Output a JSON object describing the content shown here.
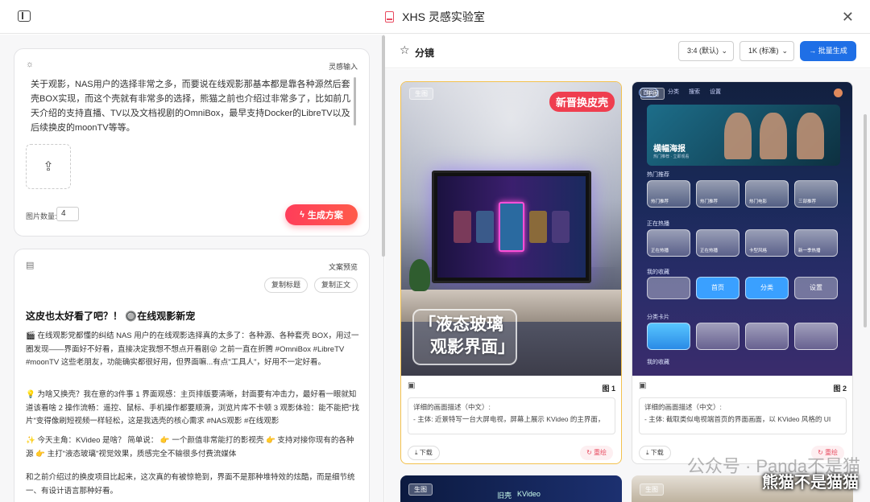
{
  "window": {
    "title": "XHS 灵感实验室"
  },
  "left": {
    "inspiration": {
      "label": "灵感输入",
      "text": "关于观影，NAS用户的选择非常之多，而要说在线观影那基本都是靠各种源然后套壳BOX实现，而这个壳就有非常多的选择，熊猫之前也介绍过非常多了，比如前几天介绍的支持直播、TV以及文档视剧的OmniBox，最早支持Docker的LibreTV以及后续换皮的moonTV等等。",
      "count_label": "图片数量:",
      "count_value": "4",
      "generate_label": "生成方案"
    },
    "copy": {
      "label": "文案预览",
      "copy_title": "复制标题",
      "copy_body": "复制正文",
      "post_title": "这皮也太好看了吧？！ 🔘在线观影新宠",
      "para1": "🎬 在线观影党都懂的纠结 NAS 用户的在线观影选择真的太多了：各种源、各种套壳 BOX，用过一圈发现——界面好不好看，直接决定我想不想点开看剧😜 之前一直在折腾 #OmniBox #LibreTV #moonTV 这些老朋友，功能确实都很好用，但界面嘛...有点\"工具人\"，好用不一定好看。",
      "para2": "💡 为啥又换壳？我在意的3件事 1 界面观感：主页排版要清晰，封面要有冲击力，最好看一眼就知道该看啥 2 操作流畅：遥控、鼠标、手机操作都要顺滑，浏览片库不卡顿 3 观影体验：能不能把\"找片\"变得像刷短视频一样轻松，这是我选壳的核心需求 #NAS观影 #在线观影",
      "para3": "✨ 今天主角：KVideo 是啥？ 简单说： 👉 一个颜值非常能打的影视壳 👉 支持对接你现有的各种源 👉 主打\"液态玻璃\"视觉效果，质感完全不输很多付费流媒体",
      "para4": "和之前介绍过的换皮项目比起来，这次真的有被惊艳到，界面不是那种堆特效的炫酷，而是细节统一、有设计语言那种好看。"
    }
  },
  "right": {
    "header": "分镜",
    "ratio_select": "3:4 (默认)",
    "size_select": "1K (标准)",
    "batch_label": "批量生成",
    "cards": [
      {
        "tag": "生图",
        "badge": "新晋换皮壳",
        "headline_line1": "「液态玻璃",
        "headline_line2": "观影界面」",
        "number": "图 1",
        "desc_line1": "详细的画面描述（中文）:",
        "desc_line2": "- 主体: 近景特写一台大屏电视，屏幕上展示 KVideo 的主界面，",
        "download": "下载",
        "redo": "重绘"
      },
      {
        "tag": "生图",
        "nav": [
          "首页",
          "分类",
          "搜索",
          "设置"
        ],
        "hero_title": "横幅海报",
        "hero_sub": "热门推荐 · 立即观看",
        "sec_hot": "热门推荐",
        "hot_items": [
          "热门推荐",
          "热门推荐",
          "热门电影",
          "三部推荐"
        ],
        "sec_playing": "正在热播",
        "playing_items": [
          "正在热播",
          "正在热播",
          "卡型风格",
          "新一季热播"
        ],
        "sec_fav": "我的收藏",
        "fav_items": [
          "首页",
          "分类",
          "设置"
        ],
        "sec_cat": "分类卡片",
        "sec_fav2": "我的收藏",
        "number": "图 2",
        "desc_line1": "详细的画面描述（中文）:",
        "desc_line2": "- 主体: 截取类似电视端首页的界面画面，以 KVideo 风格的 UI",
        "download": "下载",
        "redo": "重绘"
      }
    ],
    "bottom_cards": [
      {
        "tag": "生图",
        "t2": "旧壳",
        "t3": "KVideo"
      },
      {
        "tag": "生图"
      }
    ]
  },
  "watermark": {
    "line1": "公众号 · Panda不是猫",
    "line2": "熊猫不是猫猫"
  }
}
